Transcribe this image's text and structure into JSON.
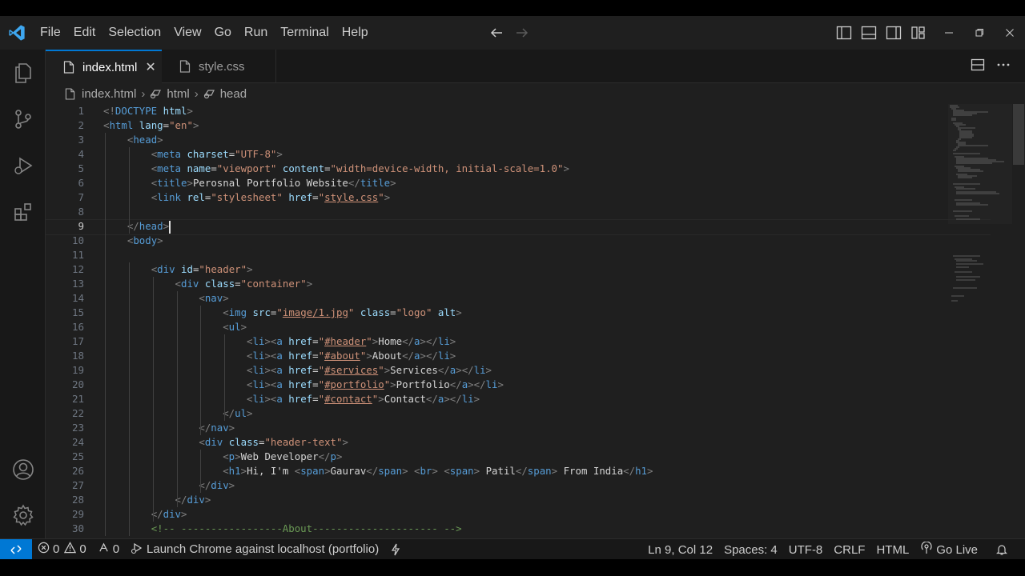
{
  "menu": [
    {
      "label": "File"
    },
    {
      "label": "Edit"
    },
    {
      "label": "Selection"
    },
    {
      "label": "View"
    },
    {
      "label": "Go"
    },
    {
      "label": "Run"
    },
    {
      "label": "Terminal"
    },
    {
      "label": "Help"
    }
  ],
  "tabs": [
    {
      "label": "index.html",
      "active": true
    },
    {
      "label": "style.css",
      "active": false
    }
  ],
  "breadcrumb": [
    {
      "label": "index.html",
      "icon": "file-icon"
    },
    {
      "label": "html",
      "icon": "symbol-icon"
    },
    {
      "label": "head",
      "icon": "symbol-icon"
    }
  ],
  "editor": {
    "current_line": 9,
    "line_numbers": [
      "1",
      "2",
      "3",
      "4",
      "5",
      "6",
      "7",
      "8",
      "9",
      "10",
      "11",
      "12",
      "13",
      "14",
      "15",
      "16",
      "17",
      "18",
      "19",
      "20",
      "21",
      "22",
      "23",
      "24",
      "25",
      "26",
      "27",
      "28",
      "29",
      "30"
    ],
    "lines": [
      {
        "indent": "",
        "tokens": [
          [
            "pun",
            "<!"
          ],
          [
            "doc",
            "DOCTYPE"
          ],
          [
            "txt",
            " "
          ],
          [
            "attr",
            "html"
          ],
          [
            "pun",
            ">"
          ]
        ]
      },
      {
        "indent": "",
        "tokens": [
          [
            "pun",
            "<"
          ],
          [
            "tag",
            "html"
          ],
          [
            "txt",
            " "
          ],
          [
            "attr",
            "lang"
          ],
          [
            "txt",
            "="
          ],
          [
            "str",
            "\"en\""
          ],
          [
            "pun",
            ">"
          ]
        ]
      },
      {
        "indent": "    ",
        "tokens": [
          [
            "pun",
            "<"
          ],
          [
            "tag",
            "head"
          ],
          [
            "pun",
            ">"
          ]
        ]
      },
      {
        "indent": "        ",
        "tokens": [
          [
            "pun",
            "<"
          ],
          [
            "tag",
            "meta"
          ],
          [
            "txt",
            " "
          ],
          [
            "attr",
            "charset"
          ],
          [
            "txt",
            "="
          ],
          [
            "str",
            "\"UTF-8\""
          ],
          [
            "pun",
            ">"
          ]
        ]
      },
      {
        "indent": "        ",
        "tokens": [
          [
            "pun",
            "<"
          ],
          [
            "tag",
            "meta"
          ],
          [
            "txt",
            " "
          ],
          [
            "attr",
            "name"
          ],
          [
            "txt",
            "="
          ],
          [
            "str",
            "\"viewport\""
          ],
          [
            "txt",
            " "
          ],
          [
            "attr",
            "content"
          ],
          [
            "txt",
            "="
          ],
          [
            "str",
            "\"width=device-width, initial-scale=1.0\""
          ],
          [
            "pun",
            ">"
          ]
        ]
      },
      {
        "indent": "        ",
        "tokens": [
          [
            "pun",
            "<"
          ],
          [
            "tag",
            "title"
          ],
          [
            "pun",
            ">"
          ],
          [
            "txt",
            "Perosnal Portfolio Website"
          ],
          [
            "pun",
            "</"
          ],
          [
            "tag",
            "title"
          ],
          [
            "pun",
            ">"
          ]
        ]
      },
      {
        "indent": "        ",
        "tokens": [
          [
            "pun",
            "<"
          ],
          [
            "tag",
            "link"
          ],
          [
            "txt",
            " "
          ],
          [
            "attr",
            "rel"
          ],
          [
            "txt",
            "="
          ],
          [
            "str",
            "\"stylesheet\""
          ],
          [
            "txt",
            " "
          ],
          [
            "attr",
            "href"
          ],
          [
            "txt",
            "="
          ],
          [
            "str",
            "\""
          ],
          [
            "link",
            "style.css"
          ],
          [
            "str",
            "\""
          ],
          [
            "pun",
            ">"
          ]
        ]
      },
      {
        "indent": "",
        "tokens": []
      },
      {
        "indent": "    ",
        "tokens": [
          [
            "pun",
            "</"
          ],
          [
            "tag",
            "head"
          ],
          [
            "pun",
            ">"
          ]
        ],
        "cursor": true
      },
      {
        "indent": "    ",
        "tokens": [
          [
            "pun",
            "<"
          ],
          [
            "tag",
            "body"
          ],
          [
            "pun",
            ">"
          ]
        ]
      },
      {
        "indent": "",
        "tokens": []
      },
      {
        "indent": "        ",
        "tokens": [
          [
            "pun",
            "<"
          ],
          [
            "tag",
            "div"
          ],
          [
            "txt",
            " "
          ],
          [
            "attr",
            "id"
          ],
          [
            "txt",
            "="
          ],
          [
            "str",
            "\"header\""
          ],
          [
            "pun",
            ">"
          ]
        ]
      },
      {
        "indent": "            ",
        "tokens": [
          [
            "pun",
            "<"
          ],
          [
            "tag",
            "div"
          ],
          [
            "txt",
            " "
          ],
          [
            "attr",
            "class"
          ],
          [
            "txt",
            "="
          ],
          [
            "str",
            "\"container\""
          ],
          [
            "pun",
            ">"
          ]
        ]
      },
      {
        "indent": "                ",
        "tokens": [
          [
            "pun",
            "<"
          ],
          [
            "tag",
            "nav"
          ],
          [
            "pun",
            ">"
          ]
        ]
      },
      {
        "indent": "                    ",
        "tokens": [
          [
            "pun",
            "<"
          ],
          [
            "tag",
            "img"
          ],
          [
            "txt",
            " "
          ],
          [
            "attr",
            "src"
          ],
          [
            "txt",
            "="
          ],
          [
            "str",
            "\""
          ],
          [
            "link",
            "image/1.jpg"
          ],
          [
            "str",
            "\""
          ],
          [
            "txt",
            " "
          ],
          [
            "attr",
            "class"
          ],
          [
            "txt",
            "="
          ],
          [
            "str",
            "\"logo\""
          ],
          [
            "txt",
            " "
          ],
          [
            "attr",
            "alt"
          ],
          [
            "pun",
            ">"
          ]
        ]
      },
      {
        "indent": "                    ",
        "tokens": [
          [
            "pun",
            "<"
          ],
          [
            "tag",
            "ul"
          ],
          [
            "pun",
            ">"
          ]
        ]
      },
      {
        "indent": "                        ",
        "tokens": [
          [
            "pun",
            "<"
          ],
          [
            "tag",
            "li"
          ],
          [
            "pun",
            "><"
          ],
          [
            "tag",
            "a"
          ],
          [
            "txt",
            " "
          ],
          [
            "attr",
            "href"
          ],
          [
            "txt",
            "="
          ],
          [
            "str",
            "\""
          ],
          [
            "link",
            "#header"
          ],
          [
            "str",
            "\""
          ],
          [
            "pun",
            ">"
          ],
          [
            "txt",
            "Home"
          ],
          [
            "pun",
            "</"
          ],
          [
            "tag",
            "a"
          ],
          [
            "pun",
            "></"
          ],
          [
            "tag",
            "li"
          ],
          [
            "pun",
            ">"
          ]
        ]
      },
      {
        "indent": "                        ",
        "tokens": [
          [
            "pun",
            "<"
          ],
          [
            "tag",
            "li"
          ],
          [
            "pun",
            "><"
          ],
          [
            "tag",
            "a"
          ],
          [
            "txt",
            " "
          ],
          [
            "attr",
            "href"
          ],
          [
            "txt",
            "="
          ],
          [
            "str",
            "\""
          ],
          [
            "link",
            "#about"
          ],
          [
            "str",
            "\""
          ],
          [
            "pun",
            ">"
          ],
          [
            "txt",
            "About"
          ],
          [
            "pun",
            "</"
          ],
          [
            "tag",
            "a"
          ],
          [
            "pun",
            "></"
          ],
          [
            "tag",
            "li"
          ],
          [
            "pun",
            ">"
          ]
        ]
      },
      {
        "indent": "                        ",
        "tokens": [
          [
            "pun",
            "<"
          ],
          [
            "tag",
            "li"
          ],
          [
            "pun",
            "><"
          ],
          [
            "tag",
            "a"
          ],
          [
            "txt",
            " "
          ],
          [
            "attr",
            "href"
          ],
          [
            "txt",
            "="
          ],
          [
            "str",
            "\""
          ],
          [
            "link",
            "#services"
          ],
          [
            "str",
            "\""
          ],
          [
            "pun",
            ">"
          ],
          [
            "txt",
            "Services"
          ],
          [
            "pun",
            "</"
          ],
          [
            "tag",
            "a"
          ],
          [
            "pun",
            "></"
          ],
          [
            "tag",
            "li"
          ],
          [
            "pun",
            ">"
          ]
        ]
      },
      {
        "indent": "                        ",
        "tokens": [
          [
            "pun",
            "<"
          ],
          [
            "tag",
            "li"
          ],
          [
            "pun",
            "><"
          ],
          [
            "tag",
            "a"
          ],
          [
            "txt",
            " "
          ],
          [
            "attr",
            "href"
          ],
          [
            "txt",
            "="
          ],
          [
            "str",
            "\""
          ],
          [
            "link",
            "#portfolio"
          ],
          [
            "str",
            "\""
          ],
          [
            "pun",
            ">"
          ],
          [
            "txt",
            "Portfolio"
          ],
          [
            "pun",
            "</"
          ],
          [
            "tag",
            "a"
          ],
          [
            "pun",
            "></"
          ],
          [
            "tag",
            "li"
          ],
          [
            "pun",
            ">"
          ]
        ]
      },
      {
        "indent": "                        ",
        "tokens": [
          [
            "pun",
            "<"
          ],
          [
            "tag",
            "li"
          ],
          [
            "pun",
            "><"
          ],
          [
            "tag",
            "a"
          ],
          [
            "txt",
            " "
          ],
          [
            "attr",
            "href"
          ],
          [
            "txt",
            "="
          ],
          [
            "str",
            "\""
          ],
          [
            "link",
            "#contact"
          ],
          [
            "str",
            "\""
          ],
          [
            "pun",
            ">"
          ],
          [
            "txt",
            "Contact"
          ],
          [
            "pun",
            "</"
          ],
          [
            "tag",
            "a"
          ],
          [
            "pun",
            "></"
          ],
          [
            "tag",
            "li"
          ],
          [
            "pun",
            ">"
          ]
        ]
      },
      {
        "indent": "                    ",
        "tokens": [
          [
            "pun",
            "</"
          ],
          [
            "tag",
            "ul"
          ],
          [
            "pun",
            ">"
          ]
        ]
      },
      {
        "indent": "                ",
        "tokens": [
          [
            "pun",
            "</"
          ],
          [
            "tag",
            "nav"
          ],
          [
            "pun",
            ">"
          ]
        ]
      },
      {
        "indent": "                ",
        "tokens": [
          [
            "pun",
            "<"
          ],
          [
            "tag",
            "div"
          ],
          [
            "txt",
            " "
          ],
          [
            "attr",
            "class"
          ],
          [
            "txt",
            "="
          ],
          [
            "str",
            "\"header-text\""
          ],
          [
            "pun",
            ">"
          ]
        ]
      },
      {
        "indent": "                    ",
        "tokens": [
          [
            "pun",
            "<"
          ],
          [
            "tag",
            "p"
          ],
          [
            "pun",
            ">"
          ],
          [
            "txt",
            "Web Developer"
          ],
          [
            "pun",
            "</"
          ],
          [
            "tag",
            "p"
          ],
          [
            "pun",
            ">"
          ]
        ]
      },
      {
        "indent": "                    ",
        "tokens": [
          [
            "pun",
            "<"
          ],
          [
            "tag",
            "h1"
          ],
          [
            "pun",
            ">"
          ],
          [
            "txt",
            "Hi, I'm "
          ],
          [
            "pun",
            "<"
          ],
          [
            "tag",
            "span"
          ],
          [
            "pun",
            ">"
          ],
          [
            "txt",
            "Gaurav"
          ],
          [
            "pun",
            "</"
          ],
          [
            "tag",
            "span"
          ],
          [
            "pun",
            ">"
          ],
          [
            "txt",
            " "
          ],
          [
            "pun",
            "<"
          ],
          [
            "tag",
            "br"
          ],
          [
            "pun",
            ">"
          ],
          [
            "txt",
            " "
          ],
          [
            "pun",
            "<"
          ],
          [
            "tag",
            "span"
          ],
          [
            "pun",
            ">"
          ],
          [
            "txt",
            " Patil"
          ],
          [
            "pun",
            "</"
          ],
          [
            "tag",
            "span"
          ],
          [
            "pun",
            ">"
          ],
          [
            "txt",
            " From India"
          ],
          [
            "pun",
            "</"
          ],
          [
            "tag",
            "h1"
          ],
          [
            "pun",
            ">"
          ]
        ]
      },
      {
        "indent": "                ",
        "tokens": [
          [
            "pun",
            "</"
          ],
          [
            "tag",
            "div"
          ],
          [
            "pun",
            ">"
          ]
        ]
      },
      {
        "indent": "            ",
        "tokens": [
          [
            "pun",
            "</"
          ],
          [
            "tag",
            "div"
          ],
          [
            "pun",
            ">"
          ]
        ]
      },
      {
        "indent": "        ",
        "tokens": [
          [
            "pun",
            "</"
          ],
          [
            "tag",
            "div"
          ],
          [
            "pun",
            ">"
          ]
        ]
      },
      {
        "indent": "        ",
        "tokens": [
          [
            "com",
            "<!-- -----------------About--------------------- -->"
          ]
        ]
      }
    ]
  },
  "statusbar": {
    "errors": "0",
    "warnings": "0",
    "ports": "0",
    "launch": "Launch Chrome against localhost (portfolio)",
    "position": "Ln 9, Col 12",
    "spaces": "Spaces: 4",
    "encoding": "UTF-8",
    "eol": "CRLF",
    "language": "HTML",
    "golive": "Go Live"
  },
  "colors": {
    "accent": "#0078d4",
    "editor_bg": "#1f1f1f",
    "tag": "#569cd6",
    "attr": "#9cdcfe",
    "string": "#ce9178",
    "comment": "#6a9955"
  }
}
